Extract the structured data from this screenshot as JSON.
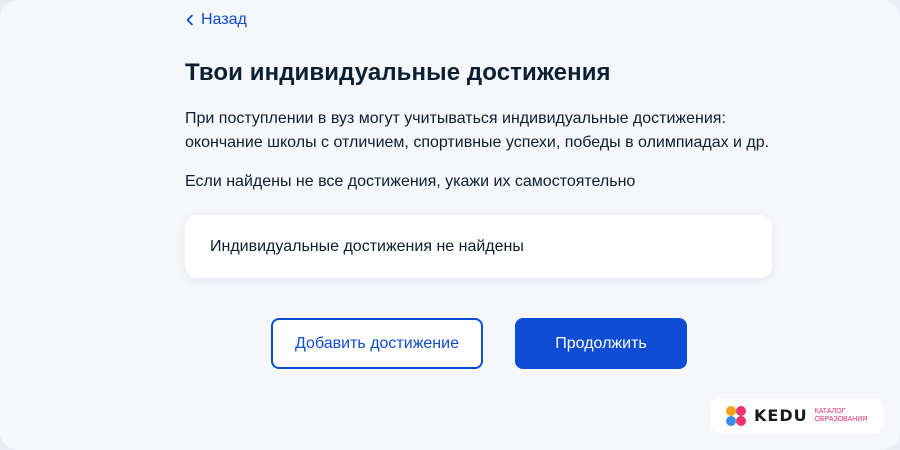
{
  "nav": {
    "back_label": "Назад"
  },
  "page": {
    "title": "Твои индивидуальные достижения",
    "intro": "При поступлении в вуз могут учитываться индивидуальные достижения: окончание школы с отличием, спортивные успехи, победы в олимпиадах и др.",
    "hint": "Если найдены не все достижения, укажи их самостоятельно"
  },
  "achievements": {
    "items": [],
    "empty_text": "Индивидуальные достижения не найдены"
  },
  "actions": {
    "add_label": "Добавить достижение",
    "continue_label": "Продолжить"
  },
  "watermark": {
    "brand": "KEDU",
    "subtitle_line1": "Каталог",
    "subtitle_line2": "образования"
  },
  "colors": {
    "accent": "#0d4cd3",
    "text": "#0b1f33",
    "background": "#f5f7fb",
    "watermark_pink": "#e8336b"
  },
  "icons": {
    "back": "chevron-left-icon",
    "watermark_logo": "kedu-logo-icon"
  }
}
